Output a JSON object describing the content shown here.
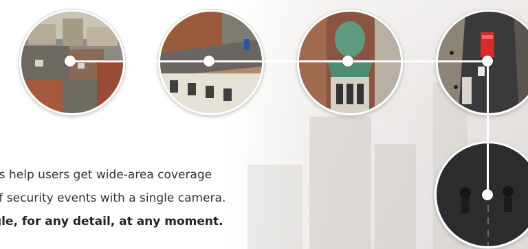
{
  "body_text": {
    "line1": "ns help users get wide-area coverage",
    "line2": "of security events with a single camera.",
    "line3": "gle, for any detail, at any moment."
  },
  "colors": {
    "connector": "#ffffff",
    "text": "#333333",
    "background": "#ffffff"
  },
  "views": [
    {
      "name": "rooftops-view"
    },
    {
      "name": "building-facade-view"
    },
    {
      "name": "green-dome-view"
    },
    {
      "name": "street-bus-view"
    },
    {
      "name": "cyclists-zoom-view"
    }
  ]
}
